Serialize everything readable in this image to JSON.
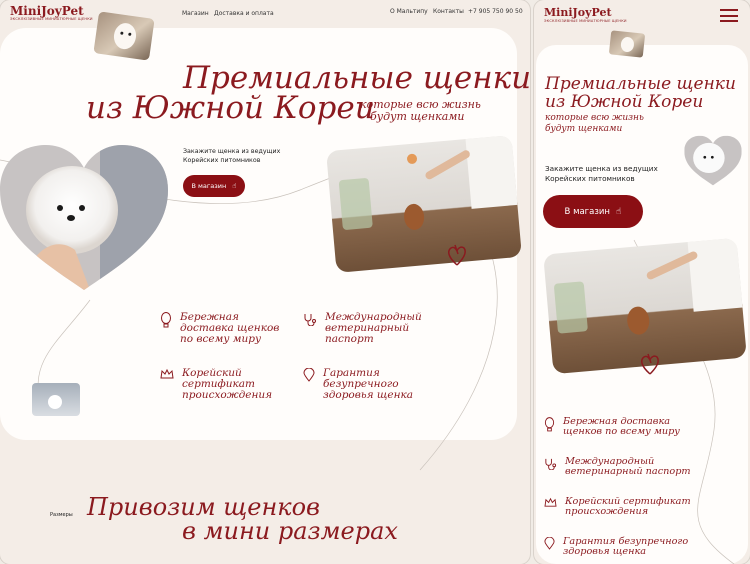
{
  "desktop": {
    "brand": "MiniJoyPet",
    "tagline": "ЭКСКЛЮЗИВНЫЕ МИНИАТЮРНЫЕ ЩЕНКИ",
    "nav": [
      "Магазин",
      "Доставка и оплата"
    ],
    "nav_right": [
      "О Мальтипу",
      "Контакты"
    ],
    "phone": "+7 905 750 90 50",
    "hero_title_line1": "Премиальные щенки",
    "hero_title_line2": "из Южной Кореи",
    "hero_subtitle_line1": "которые всю жизнь",
    "hero_subtitle_line2": "будут щенками",
    "order_text_line1": "Закажите щенка из ведущих",
    "order_text_line2": "Корейских питомников",
    "shop_button": "В магазин",
    "features": [
      {
        "icon": "balloon-icon",
        "text": "Бережная\nдоставка щенков\nпо всему миру"
      },
      {
        "icon": "stethoscope-icon",
        "text": "Международный\nветеринарный\nпаспорт"
      },
      {
        "icon": "crown-icon",
        "text": "Корейский\nсертификат\nпроисхождения"
      },
      {
        "icon": "pin-icon",
        "text": "Гарантия\nбезупречного\nздоровья щенка"
      }
    ],
    "sizes_label": "Размеры",
    "sizes_title_line1": "Привозим щенков",
    "sizes_title_line2": "в мини размерах"
  },
  "mobile": {
    "brand": "MiniJoyPet",
    "tagline": "ЭКСКЛЮЗИВНЫЕ МИНИАТЮРНЫЕ ЩЕНКИ",
    "hero_title_line1": "Премиальные щенки",
    "hero_title_line2": "из Южной Кореи",
    "hero_subtitle_line1": "которые всю жизнь",
    "hero_subtitle_line2": "будут щенками",
    "order_text_line1": "Закажите щенка из ведущих",
    "order_text_line2": "Корейских питомников",
    "shop_button": "В магазин",
    "features": [
      {
        "icon": "balloon-icon",
        "text": "Бережная доставка\nщенков по всему миру"
      },
      {
        "icon": "stethoscope-icon",
        "text": "Международный\nветеринарный паспорт"
      },
      {
        "icon": "crown-icon",
        "text": "Корейский сертификат\nпроисхождения"
      },
      {
        "icon": "pin-icon",
        "text": "Гарантия безупречного\nздоровья щенка"
      }
    ]
  },
  "colors": {
    "accent": "#8b1a1f",
    "button": "#8b0f14",
    "background": "#f4ede7",
    "card": "#fffdfb"
  }
}
